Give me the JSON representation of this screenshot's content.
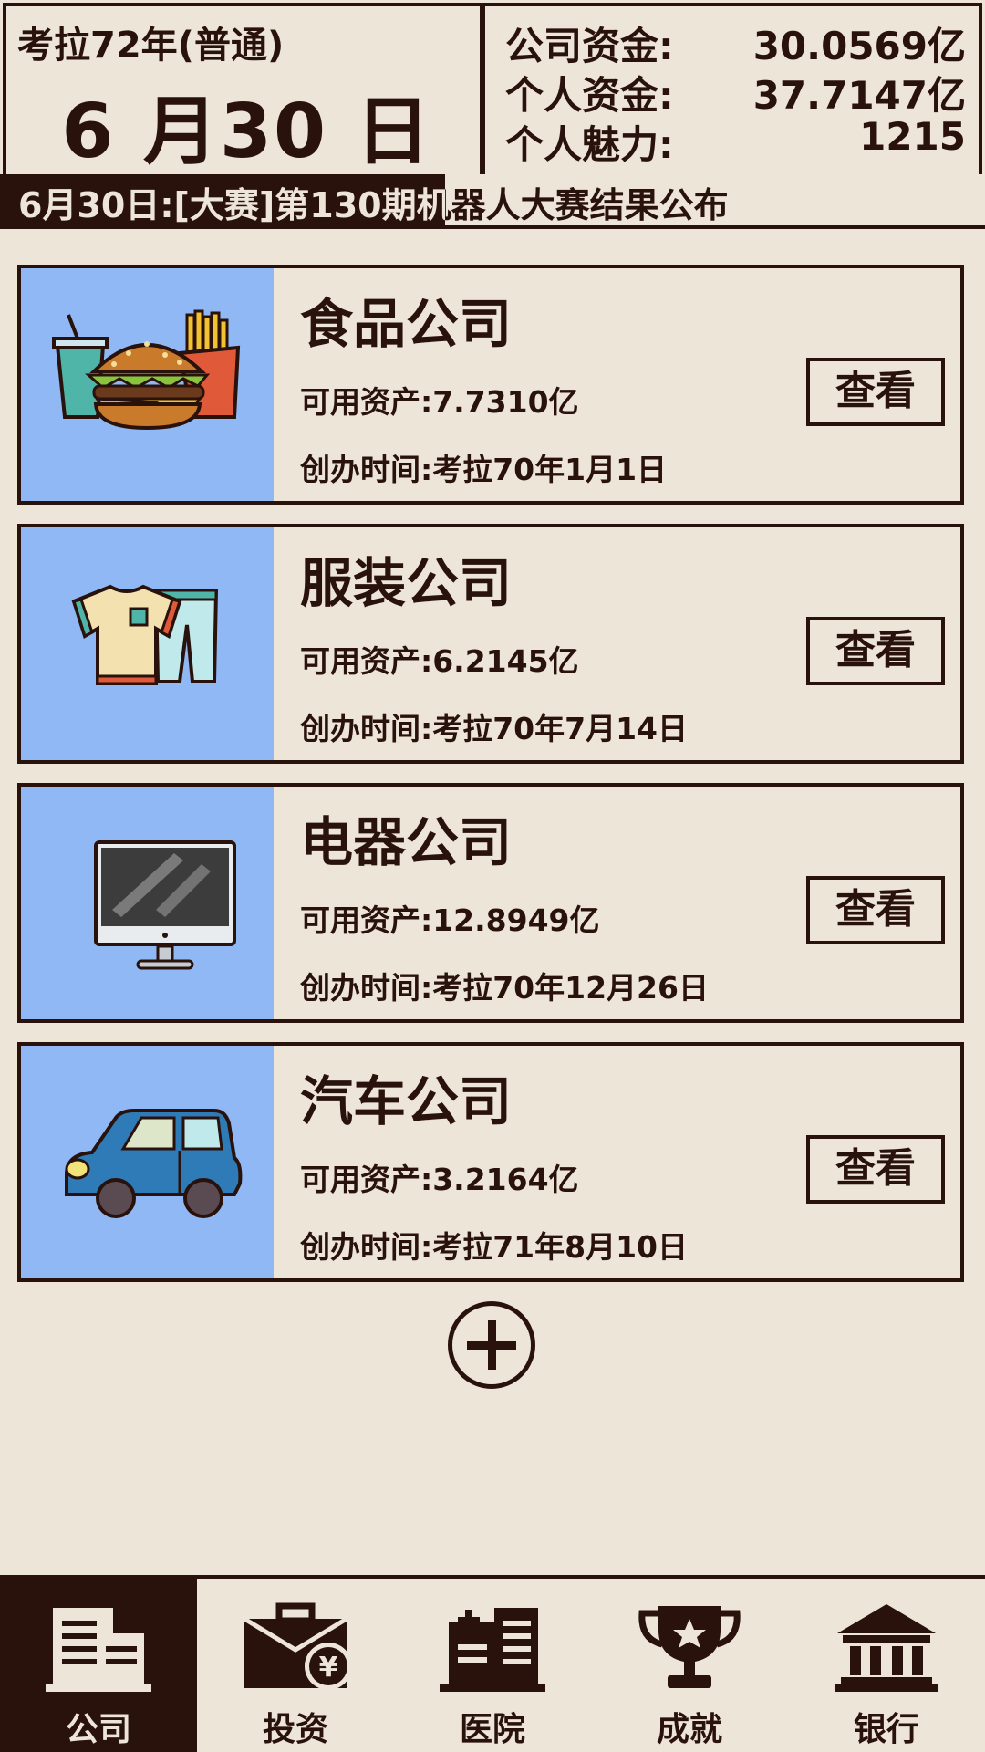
{
  "header": {
    "year_label": "考拉72年(普通)",
    "date_label": "6 月30 日",
    "stats": [
      {
        "label": "公司资金:",
        "value": "30.0569亿"
      },
      {
        "label": "个人资金:",
        "value": "37.7147亿"
      },
      {
        "label": "个人魅力:",
        "value": "1215"
      }
    ]
  },
  "ticker": {
    "text": "6月30日:[大赛]第130期机器人大赛结果公布"
  },
  "companies": [
    {
      "name": "食品公司",
      "assets": "可用资产:7.7310亿",
      "founded": "创办时间:考拉70年1月1日",
      "view_label": "查看",
      "icon": "food-icon"
    },
    {
      "name": "服装公司",
      "assets": "可用资产:6.2145亿",
      "founded": "创办时间:考拉70年7月14日",
      "view_label": "查看",
      "icon": "clothing-icon"
    },
    {
      "name": "电器公司",
      "assets": "可用资产:12.8949亿",
      "founded": "创办时间:考拉70年12月26日",
      "view_label": "查看",
      "icon": "computer-icon"
    },
    {
      "name": "汽车公司",
      "assets": "可用资产:3.2164亿",
      "founded": "创办时间:考拉71年8月10日",
      "view_label": "查看",
      "icon": "car-icon"
    }
  ],
  "nav": [
    {
      "label": "公司",
      "icon": "building-icon",
      "active": true
    },
    {
      "label": "投资",
      "icon": "briefcase-yen-icon",
      "active": false
    },
    {
      "label": "医院",
      "icon": "hospital-icon",
      "active": false
    },
    {
      "label": "成就",
      "icon": "trophy-icon",
      "active": false
    },
    {
      "label": "银行",
      "icon": "bank-icon",
      "active": false
    }
  ],
  "colors": {
    "background": "#ede5d8",
    "ink": "#2a120c",
    "card_image_bg": "#8fb8f5"
  }
}
